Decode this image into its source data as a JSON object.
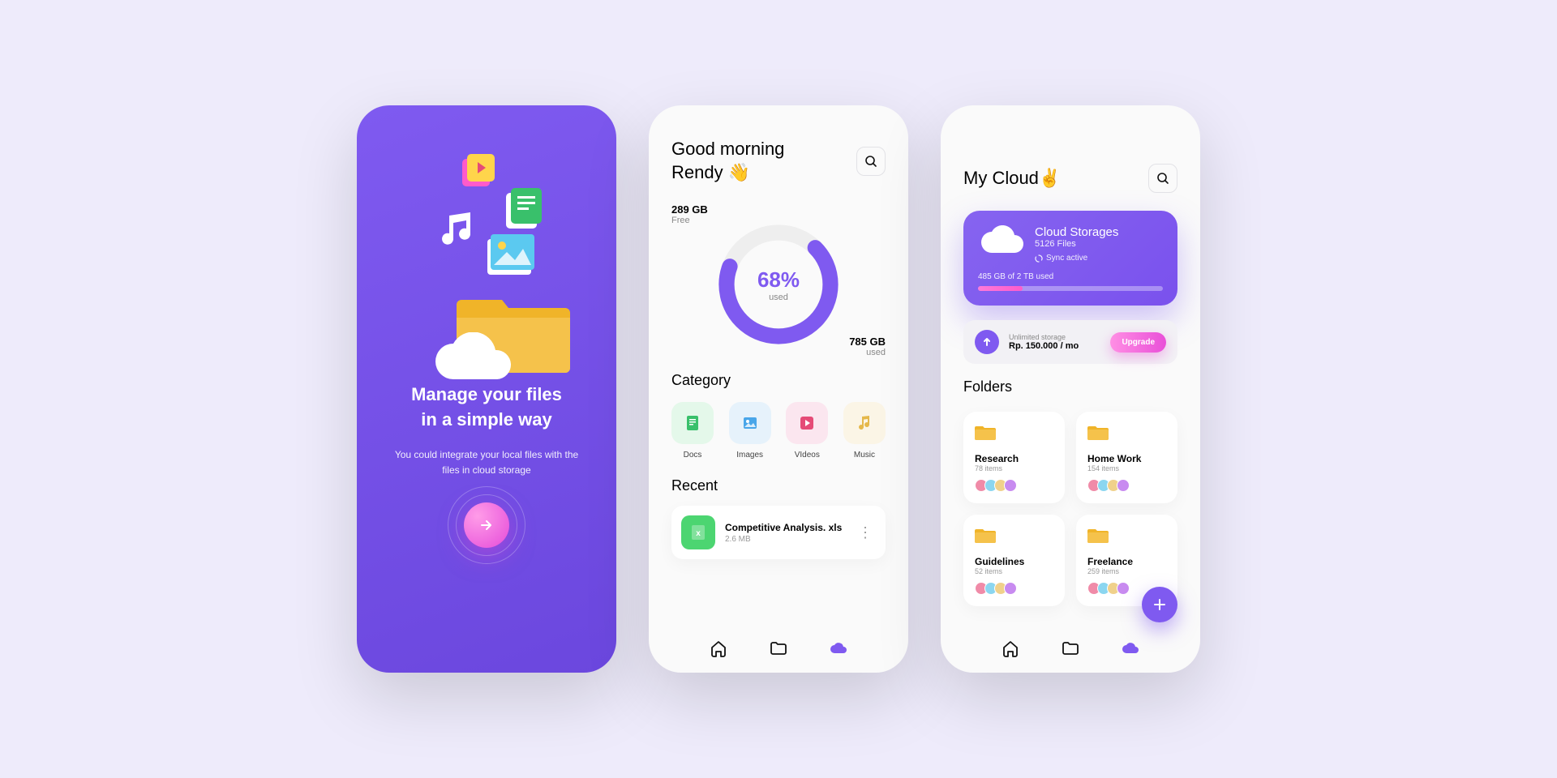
{
  "onboard": {
    "title_line1": "Manage your files",
    "title_line2": "in a simple way",
    "subtitle": "You could integrate your local files with the files in cloud storage"
  },
  "dashboard": {
    "greeting_line1": "Good morning",
    "greeting_line2": "Rendy 👋",
    "free_value": "289 GB",
    "free_label": "Free",
    "used_value": "785 GB",
    "used_label": "used",
    "used_percent": "68%",
    "used_percent_label": "used",
    "category_heading": "Category",
    "recent_heading": "Recent",
    "categories": [
      {
        "label": "Docs",
        "color": "#e4f8ea",
        "icon_color": "#39c06b"
      },
      {
        "label": "Images",
        "color": "#e6f2fb",
        "icon_color": "#49a6e9"
      },
      {
        "label": "VIdeos",
        "color": "#fbe6ef",
        "icon_color": "#e54b77"
      },
      {
        "label": "Music",
        "color": "#fbf5e6",
        "icon_color": "#e5b84b"
      }
    ],
    "recent": {
      "name": "Competitive Analysis. xls",
      "size": "2.6 MB"
    }
  },
  "cloud": {
    "title": "My Cloud✌️",
    "card": {
      "title": "Cloud Storages",
      "files": "5126 Files",
      "sync": "Sync active",
      "bar_label": "485 GB of 2 TB used",
      "fill_percent": 24
    },
    "upgrade": {
      "line1": "Unlimited storage",
      "line2": "Rp. 150.000 / mo",
      "button": "Upgrade"
    },
    "folders_heading": "Folders",
    "folders": [
      {
        "name": "Research",
        "count": "78 items"
      },
      {
        "name": "Home Work",
        "count": "154 items"
      },
      {
        "name": "Guidelines",
        "count": "52 items"
      },
      {
        "name": "Freelance",
        "count": "259 items"
      }
    ]
  },
  "colors": {
    "primary": "#7f5af0"
  }
}
